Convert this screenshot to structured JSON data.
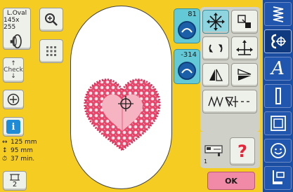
{
  "hoop": {
    "name_line1": "L.Oval",
    "name_line2": "145x 255"
  },
  "check": {
    "label": "Check"
  },
  "dimensions": {
    "width": "125 mm",
    "height": "95 mm",
    "time": "37 min.",
    "width_symbol": "↔",
    "height_symbol": "↕",
    "time_symbol": "⏱"
  },
  "repeat": {
    "count": "2"
  },
  "position": {
    "horizontal": "81",
    "vertical": "-314"
  },
  "ok_button": {
    "label": "OK"
  },
  "sidebar": {
    "items": [
      "embroidery-icon",
      "edit-icon",
      "alphabet-icon",
      "thread-icon",
      "frame-icon",
      "personal-icon",
      "sewing-icon"
    ],
    "alphabet_glyph": "A"
  },
  "colors": {
    "background": "#f5cc21",
    "design": "#e8476b",
    "design_light": "#f6b3c2",
    "accent_cyan": "#63c9d6",
    "sidebar_blue": "#1b4ea0",
    "ok_pink": "#f08aa6",
    "help_red": "#e5253a"
  }
}
